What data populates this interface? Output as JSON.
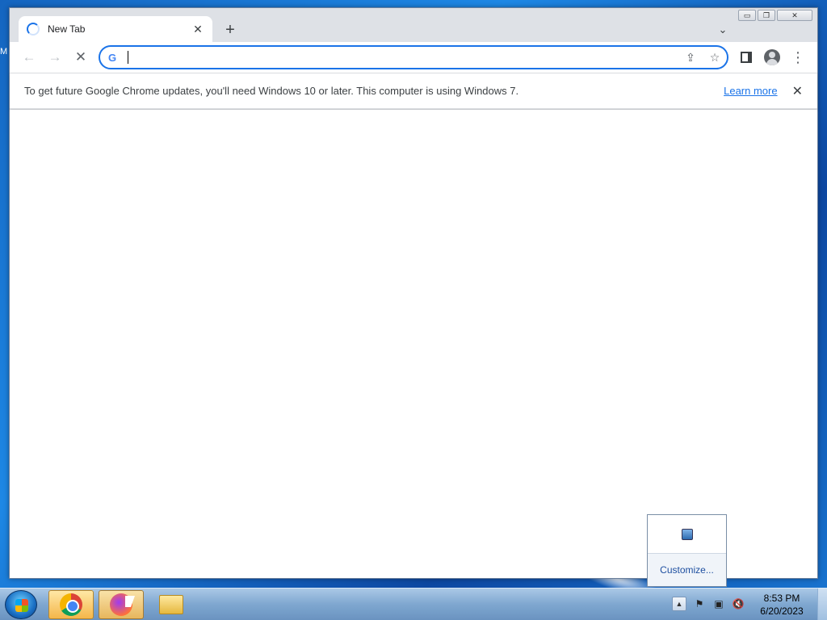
{
  "desktop": {
    "edge_text": "M"
  },
  "browser": {
    "tab": {
      "title": "New Tab",
      "close_glyph": "✕"
    },
    "new_tab_glyph": "+",
    "tab_search_glyph": "⌄",
    "caption": {
      "minimize": "▭",
      "restore": "❐",
      "close": "✕"
    },
    "toolbar": {
      "back": "←",
      "forward": "→",
      "stop": "✕",
      "omnibox_value": "",
      "google_glyph": "G",
      "share_glyph": "⇪",
      "bookmark_glyph": "☆",
      "menu_glyph": "⋮"
    },
    "infobar": {
      "message": "To get future Google Chrome updates, you'll need Windows 10 or later. This computer is using Windows 7.",
      "link": "Learn more",
      "close_glyph": "✕"
    }
  },
  "tray_popup": {
    "customize_label": "Customize..."
  },
  "taskbar": {
    "tray_up_glyph": "▲",
    "tray_icons": [
      "action-center-icon",
      "network-icon",
      "volume-muted-icon"
    ],
    "tray_glyphs": {
      "action": "⚑",
      "network": "▣",
      "volume": "🔇"
    },
    "clock": {
      "time": "8:53 PM",
      "date": "6/20/2023"
    }
  }
}
